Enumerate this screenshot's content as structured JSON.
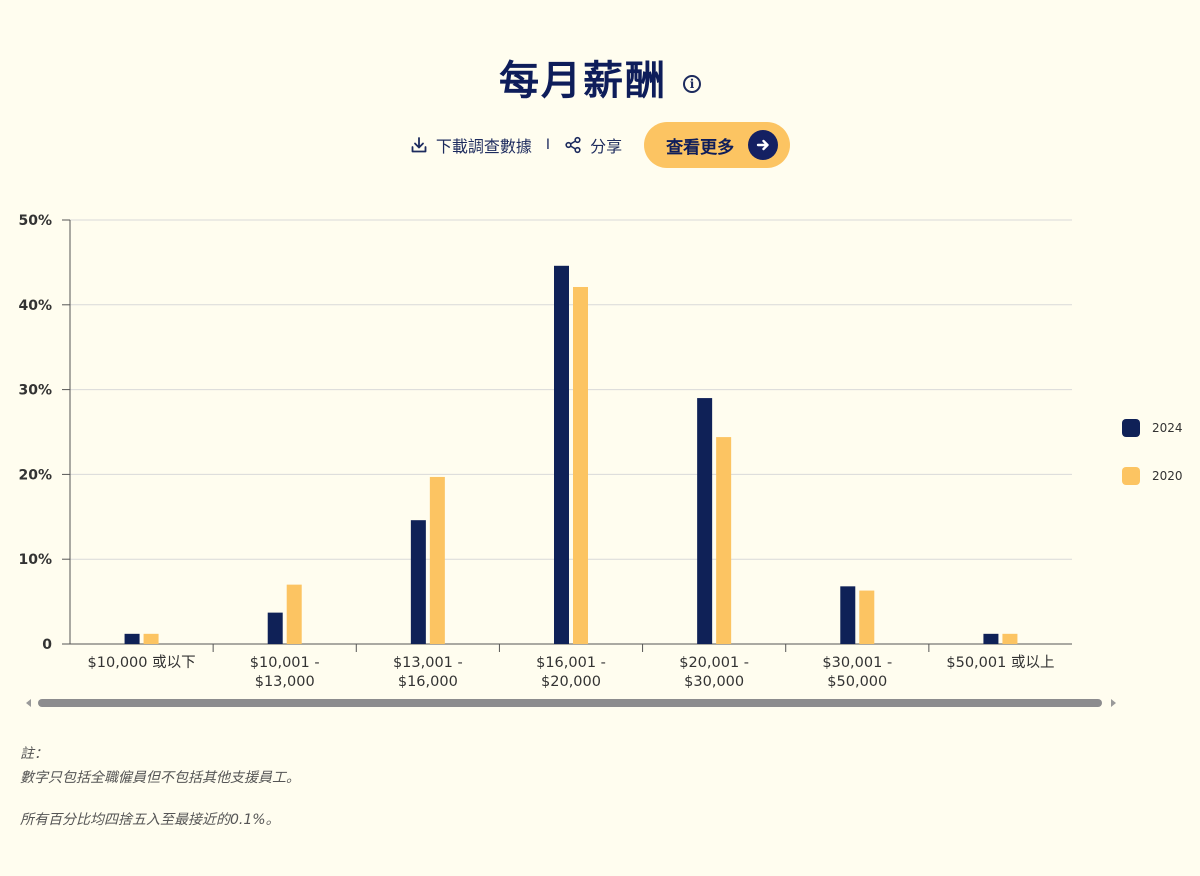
{
  "header": {
    "title": "每月薪酬",
    "info_icon": "info-icon",
    "download_label": "下載調查數據",
    "separator": "I",
    "share_label": "分享",
    "more_label": "查看更多"
  },
  "colors": {
    "series_2024": "#0f2157",
    "series_2020": "#fcc462",
    "background": "#fffdef",
    "button": "#fcc462"
  },
  "chart_data": {
    "type": "bar",
    "title": "",
    "xlabel": "",
    "ylabel": "",
    "ylim": [
      0,
      50
    ],
    "yticks": [
      "0",
      "10%",
      "20%",
      "30%",
      "40%",
      "50%"
    ],
    "grid": true,
    "legend_position": "right",
    "categories": [
      [
        "$10,000 或以下"
      ],
      [
        "$10,001 -",
        "$13,000"
      ],
      [
        "$13,001 -",
        "$16,000"
      ],
      [
        "$16,001 -",
        "$20,000"
      ],
      [
        "$20,001 -",
        "$30,000"
      ],
      [
        "$30,001 -",
        "$50,000"
      ],
      [
        "$50,001 或以上"
      ]
    ],
    "series": [
      {
        "name": "2024",
        "color": "#0f2157",
        "values": [
          1.2,
          3.7,
          14.6,
          44.6,
          29.0,
          6.8,
          1.2
        ]
      },
      {
        "name": "2020",
        "color": "#fcc462",
        "values": [
          1.2,
          7.0,
          19.7,
          42.1,
          24.4,
          6.3,
          1.2
        ]
      }
    ]
  },
  "notes": {
    "heading": "註：",
    "line1": "數字只包括全職僱員但不包括其他支援員工。",
    "line2": "所有百分比均四捨五入至最接近的0.1%。"
  }
}
